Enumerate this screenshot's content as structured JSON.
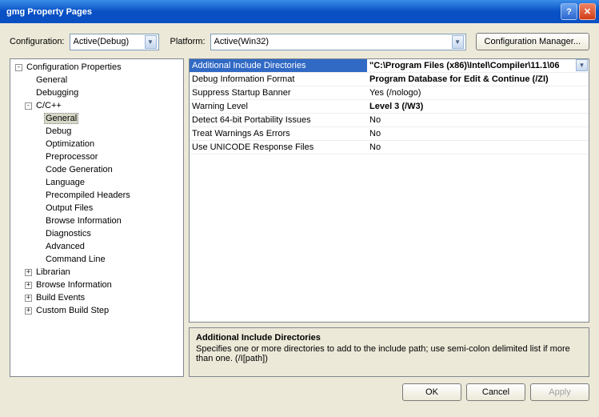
{
  "window": {
    "title": "gmg Property Pages"
  },
  "toolbar": {
    "config_label": "Configuration:",
    "config_value": "Active(Debug)",
    "platform_label": "Platform:",
    "platform_value": "Active(Win32)",
    "config_mgr": "Configuration Manager..."
  },
  "tree": {
    "root": "Configuration Properties",
    "general": "General",
    "debugging": "Debugging",
    "ccpp": "C/C++",
    "cc_general": "General",
    "cc_debug": "Debug",
    "cc_opt": "Optimization",
    "cc_pre": "Preprocessor",
    "cc_code": "Code Generation",
    "cc_lang": "Language",
    "cc_pch": "Precompiled Headers",
    "cc_out": "Output Files",
    "cc_browse": "Browse Information",
    "cc_diag": "Diagnostics",
    "cc_adv": "Advanced",
    "cc_cmd": "Command Line",
    "librarian": "Librarian",
    "browseinfo": "Browse Information",
    "buildev": "Build Events",
    "custom": "Custom Build Step"
  },
  "grid": {
    "r0n": "Additional Include Directories",
    "r0v": "\"C:\\Program Files (x86)\\Intel\\Compiler\\11.1\\06",
    "r1n": "Debug Information Format",
    "r1v": "Program Database for Edit & Continue (/ZI)",
    "r2n": "Suppress Startup Banner",
    "r2v": "Yes (/nologo)",
    "r3n": "Warning Level",
    "r3v": "Level 3 (/W3)",
    "r4n": "Detect 64-bit Portability Issues",
    "r4v": "No",
    "r5n": "Treat Warnings As Errors",
    "r5v": "No",
    "r6n": "Use UNICODE Response Files",
    "r6v": "No"
  },
  "desc": {
    "title": "Additional Include Directories",
    "text": "Specifies one or more directories to add to the include path; use semi-colon delimited list if more than one.     (/I[path])"
  },
  "footer": {
    "ok": "OK",
    "cancel": "Cancel",
    "apply": "Apply"
  }
}
